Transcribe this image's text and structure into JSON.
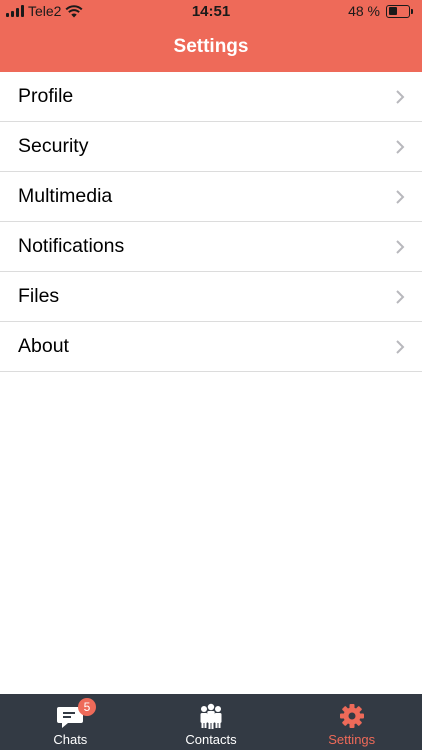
{
  "status_bar": {
    "carrier": "Tele2",
    "time": "14:51",
    "battery_text": "48 %",
    "battery_level": 0.48
  },
  "header": {
    "title": "Settings",
    "background": "#ee6a59"
  },
  "settings": {
    "items": [
      {
        "label": "Profile"
      },
      {
        "label": "Security"
      },
      {
        "label": "Multimedia"
      },
      {
        "label": "Notifications"
      },
      {
        "label": "Files"
      },
      {
        "label": "About"
      }
    ]
  },
  "tabbar": {
    "background": "#333a44",
    "tabs": [
      {
        "label": "Chats",
        "icon": "chat-icon",
        "badge": "5",
        "active": false
      },
      {
        "label": "Contacts",
        "icon": "contacts-icon",
        "active": false
      },
      {
        "label": "Settings",
        "icon": "gear-icon",
        "active": true
      }
    ]
  }
}
